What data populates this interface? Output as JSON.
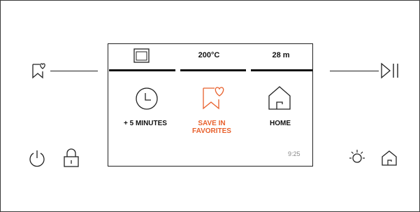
{
  "tabs": [
    {
      "label": "",
      "icon": "oven-icon"
    },
    {
      "label": "200°C"
    },
    {
      "label": "28 m"
    }
  ],
  "menu": [
    {
      "label": "+ 5 MINUTES",
      "icon": "clock-icon"
    },
    {
      "label": "SAVE IN\nFAVORITES",
      "icon": "favorite-bookmark-icon",
      "highlighted": true
    },
    {
      "label": "HOME",
      "icon": "home-icon"
    }
  ],
  "screen": {
    "time": "9:25"
  },
  "left_buttons": [
    "favorite-bookmark-icon",
    "power-icon",
    "lock-icon"
  ],
  "right_buttons": [
    "play-pause-icon",
    "light-icon",
    "home-icon"
  ],
  "colors": {
    "accent": "#e8602c",
    "line": "#222222",
    "time_text": "#888888"
  }
}
